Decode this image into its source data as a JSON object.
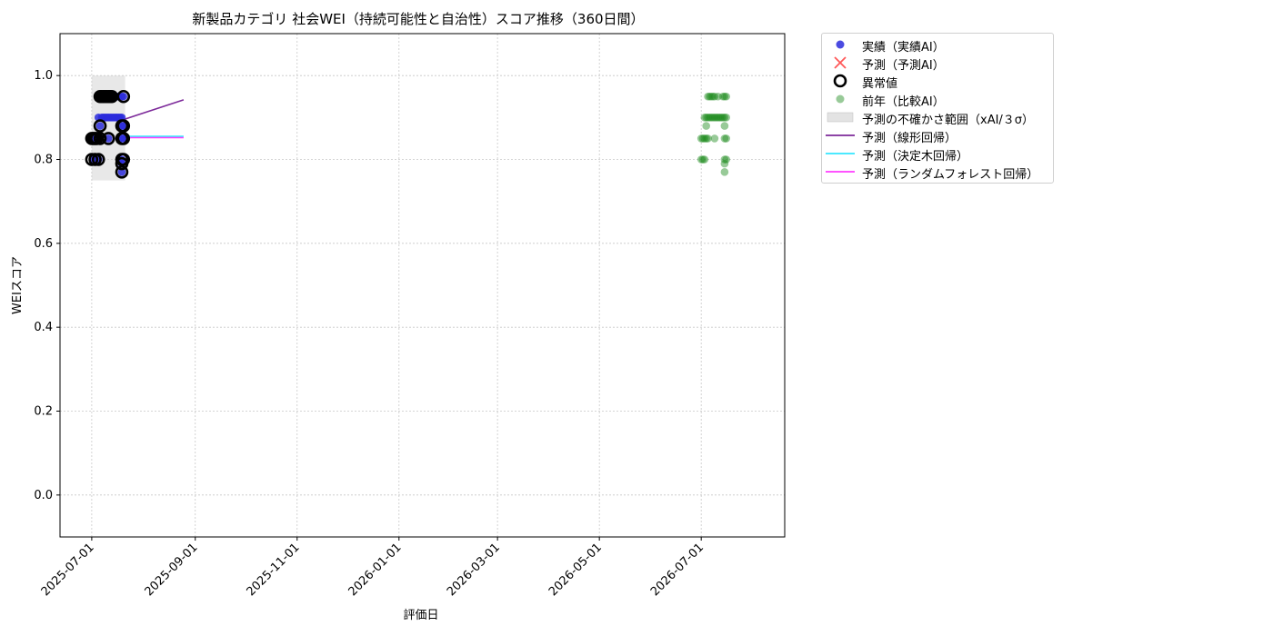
{
  "chart_data": {
    "type": "scatter",
    "title": "新製品カテゴリ 社会WEI（持続可能性と自治性）スコア推移（360日間）",
    "xlabel": "評価日",
    "ylabel": "WEIスコア",
    "xlim": [
      "2025-06-12",
      "2026-08-20"
    ],
    "ylim": [
      -0.1,
      1.1
    ],
    "grid": true,
    "legend_position": "outside-top-right",
    "x_ticks": [
      "2025-07-01",
      "2025-09-01",
      "2025-11-01",
      "2026-01-01",
      "2026-03-01",
      "2026-05-01",
      "2026-07-01"
    ],
    "y_ticks": [
      "0.0",
      "0.2",
      "0.4",
      "0.6",
      "0.8",
      "1.0"
    ],
    "uncertainty_band": {
      "label": "予測の不確かさ範囲（xAI/３σ）",
      "x": [
        "2025-07-01",
        "2025-07-21"
      ],
      "y": [
        0.75,
        1.0
      ],
      "color": "#cccccc"
    },
    "series": [
      {
        "name": "実績（実績AI）",
        "kind": "scatter",
        "color": "#2b2bdc",
        "points": [
          [
            "2025-07-02",
            0.8
          ],
          [
            "2025-07-03",
            0.85
          ],
          [
            "2025-07-04",
            0.85
          ],
          [
            "2025-07-05",
            0.8
          ],
          [
            "2025-07-05",
            0.9
          ],
          [
            "2025-07-06",
            0.85
          ],
          [
            "2025-07-06",
            0.88
          ],
          [
            "2025-07-06",
            0.95
          ],
          [
            "2025-07-07",
            0.9
          ],
          [
            "2025-07-07",
            0.95
          ],
          [
            "2025-07-08",
            0.9
          ],
          [
            "2025-07-08",
            0.95
          ],
          [
            "2025-07-09",
            0.9
          ],
          [
            "2025-07-09",
            0.95
          ],
          [
            "2025-07-10",
            0.9
          ],
          [
            "2025-07-10",
            0.95
          ],
          [
            "2025-07-11",
            0.85
          ],
          [
            "2025-07-11",
            0.9
          ],
          [
            "2025-07-12",
            0.9
          ],
          [
            "2025-07-12",
            0.95
          ],
          [
            "2025-07-13",
            0.9
          ],
          [
            "2025-07-13",
            0.95
          ],
          [
            "2025-07-14",
            0.9
          ],
          [
            "2025-07-15",
            0.9
          ],
          [
            "2025-07-15",
            0.95
          ],
          [
            "2025-07-16",
            0.9
          ],
          [
            "2025-07-16",
            0.95
          ],
          [
            "2025-07-17",
            0.9
          ],
          [
            "2025-07-17",
            0.95
          ],
          [
            "2025-07-18",
            0.9
          ],
          [
            "2025-07-19",
            0.77
          ],
          [
            "2025-07-19",
            0.79
          ],
          [
            "2025-07-19",
            0.8
          ],
          [
            "2025-07-19",
            0.85
          ],
          [
            "2025-07-19",
            0.88
          ],
          [
            "2025-07-19",
            0.9
          ],
          [
            "2025-07-19",
            0.95
          ],
          [
            "2025-07-20",
            0.85
          ],
          [
            "2025-07-20",
            0.88
          ],
          [
            "2025-07-20",
            0.95
          ]
        ]
      },
      {
        "name": "予測（予測AI）",
        "kind": "marker-x",
        "color": "#ff3b3b",
        "points": []
      },
      {
        "name": "異常値",
        "kind": "ring",
        "color": "#000000",
        "points": [
          [
            "2025-07-01",
            0.8
          ],
          [
            "2025-07-01",
            0.85
          ],
          [
            "2025-07-02",
            0.85
          ],
          [
            "2025-07-03",
            0.8
          ],
          [
            "2025-07-03",
            0.85
          ],
          [
            "2025-07-04",
            0.85
          ],
          [
            "2025-07-05",
            0.8
          ],
          [
            "2025-07-06",
            0.85
          ],
          [
            "2025-07-06",
            0.88
          ],
          [
            "2025-07-06",
            0.95
          ],
          [
            "2025-07-07",
            0.95
          ],
          [
            "2025-07-08",
            0.95
          ],
          [
            "2025-07-09",
            0.95
          ],
          [
            "2025-07-10",
            0.95
          ],
          [
            "2025-07-11",
            0.85
          ],
          [
            "2025-07-11",
            0.95
          ],
          [
            "2025-07-12",
            0.95
          ],
          [
            "2025-07-13",
            0.95
          ],
          [
            "2025-07-19",
            0.77
          ],
          [
            "2025-07-19",
            0.79
          ],
          [
            "2025-07-19",
            0.8
          ],
          [
            "2025-07-19",
            0.85
          ],
          [
            "2025-07-19",
            0.88
          ],
          [
            "2025-07-20",
            0.8
          ],
          [
            "2025-07-20",
            0.85
          ],
          [
            "2025-07-20",
            0.88
          ],
          [
            "2025-07-20",
            0.95
          ]
        ]
      },
      {
        "name": "前年（比較AI）",
        "kind": "scatter-faint",
        "color": "#1a8a1a",
        "points": [
          [
            "2026-07-01",
            0.8
          ],
          [
            "2026-07-01",
            0.85
          ],
          [
            "2026-07-02",
            0.8
          ],
          [
            "2026-07-02",
            0.85
          ],
          [
            "2026-07-03",
            0.8
          ],
          [
            "2026-07-03",
            0.85
          ],
          [
            "2026-07-03",
            0.9
          ],
          [
            "2026-07-04",
            0.85
          ],
          [
            "2026-07-04",
            0.88
          ],
          [
            "2026-07-04",
            0.9
          ],
          [
            "2026-07-05",
            0.85
          ],
          [
            "2026-07-05",
            0.9
          ],
          [
            "2026-07-05",
            0.95
          ],
          [
            "2026-07-06",
            0.9
          ],
          [
            "2026-07-06",
            0.95
          ],
          [
            "2026-07-07",
            0.9
          ],
          [
            "2026-07-07",
            0.95
          ],
          [
            "2026-07-08",
            0.9
          ],
          [
            "2026-07-08",
            0.95
          ],
          [
            "2026-07-09",
            0.85
          ],
          [
            "2026-07-09",
            0.9
          ],
          [
            "2026-07-09",
            0.95
          ],
          [
            "2026-07-10",
            0.9
          ],
          [
            "2026-07-11",
            0.9
          ],
          [
            "2026-07-11",
            0.95
          ],
          [
            "2026-07-12",
            0.9
          ],
          [
            "2026-07-13",
            0.9
          ],
          [
            "2026-07-14",
            0.9
          ],
          [
            "2026-07-14",
            0.95
          ],
          [
            "2026-07-15",
            0.77
          ],
          [
            "2026-07-15",
            0.79
          ],
          [
            "2026-07-15",
            0.8
          ],
          [
            "2026-07-15",
            0.85
          ],
          [
            "2026-07-15",
            0.88
          ],
          [
            "2026-07-15",
            0.9
          ],
          [
            "2026-07-15",
            0.95
          ],
          [
            "2026-07-16",
            0.8
          ],
          [
            "2026-07-16",
            0.85
          ],
          [
            "2026-07-16",
            0.9
          ],
          [
            "2026-07-16",
            0.95
          ]
        ]
      },
      {
        "name": "予測（線形回帰）",
        "kind": "line",
        "color": "#7d2a9a",
        "points": [
          [
            "2025-07-20",
            0.895
          ],
          [
            "2025-08-25",
            0.942
          ]
        ]
      },
      {
        "name": "予測（決定木回帰）",
        "kind": "line",
        "color": "#33e6ff",
        "points": [
          [
            "2025-07-20",
            0.855
          ],
          [
            "2025-08-25",
            0.855
          ]
        ]
      },
      {
        "name": "予測（ランダムフォレスト回帰）",
        "kind": "line",
        "color": "#ff3bff",
        "points": [
          [
            "2025-07-20",
            0.852
          ],
          [
            "2025-08-25",
            0.852
          ]
        ]
      }
    ],
    "legend_order": [
      "実績（実績AI）",
      "予測（予測AI）",
      "異常値",
      "前年（比較AI）",
      "予測の不確かさ範囲（xAI/３σ）",
      "予測（線形回帰）",
      "予測（決定木回帰）",
      "予測（ランダムフォレスト回帰）"
    ]
  }
}
